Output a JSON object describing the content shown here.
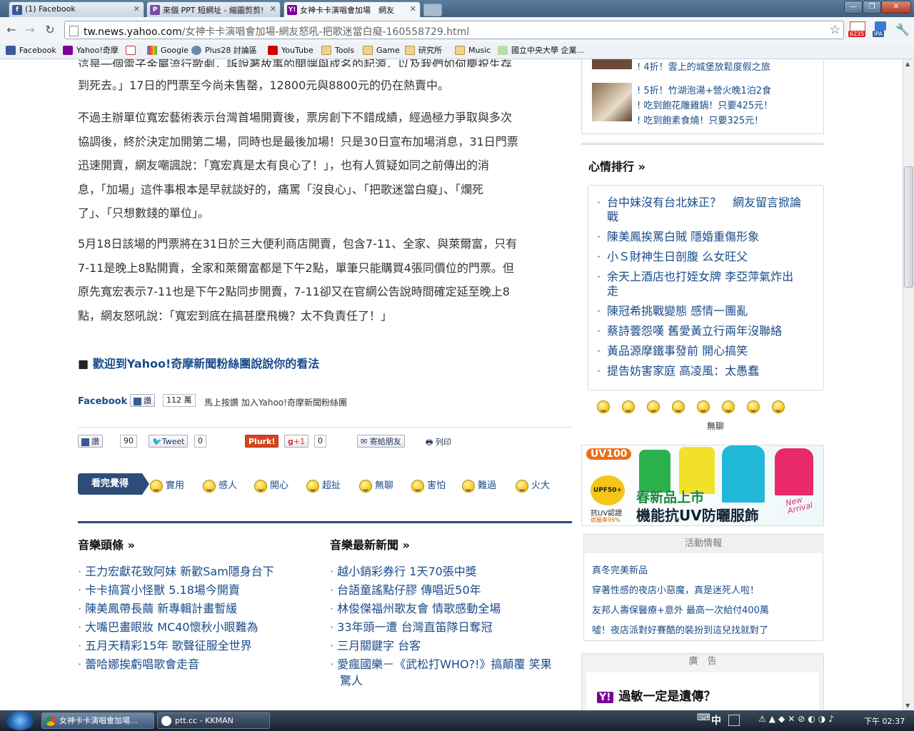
{
  "browser": {
    "tabs": [
      {
        "label": "(1) Facebook",
        "icon": "facebook-icon",
        "color": "#3b5998"
      },
      {
        "label": "來個 PPT 短網址 - 縮圖剪剪!",
        "icon": "ppt-icon",
        "color": "#7a4da0"
      },
      {
        "label": "女神卡卡演唱會加場　網友",
        "icon": "yahoo-icon",
        "color": "#7b0099"
      }
    ],
    "url_host": "tw.news.yahoo.com",
    "url_path": "/女神卡卡演唱會加場-網友怒吼-把歌迷當白癡-160558729.html",
    "ext_badge_1": "6235",
    "ext_badge_2": "IPA",
    "bookmarks": [
      {
        "label": "Facebook",
        "icon": "facebook-icon"
      },
      {
        "label": "Yahoo!奇摩",
        "icon": "yahoo-icon"
      },
      {
        "label": "",
        "icon": "gmail-icon"
      },
      {
        "label": "Google",
        "icon": "google-icon"
      },
      {
        "label": "Plus28 討論區",
        "icon": "plus28-icon"
      },
      {
        "label": "YouTube",
        "icon": "youtube-icon"
      },
      {
        "label": "Tools",
        "icon": "folder-icon"
      },
      {
        "label": "Game",
        "icon": "folder-icon"
      },
      {
        "label": "研究所",
        "icon": "folder-icon"
      },
      {
        "label": "Music",
        "icon": "folder-icon"
      },
      {
        "label": "國立中央大學 企業...",
        "icon": "ncu-icon"
      }
    ]
  },
  "article": {
    "para1_top": "這是一個電子金屬流行歌劇，訴說著故事的開端與成名的起源，以及我們如何慶祝生存",
    "para1_mid": "到死去。」17日的門票至今尚未售罄，12800元與8800元的仍在熱賣中。",
    "para2": [
      "不過主辦單位寬宏藝術表示台灣首場開賣後，票房創下不錯成績，經過極力爭取與多次",
      "協調後，終於決定加開第二場，同時也是最後加場！只是30日宣布加場消息，31日門票",
      "迅速開賣，網友嘲諷說：「寬宏真是太有良心了！」，也有人質疑如同之前傳出的消",
      "息，「加場」這件事根本是早就談好的，痛罵「沒良心」、「把歌迷當白癡」、「爛死",
      "了」、「只想數錢的單位」。"
    ],
    "para3": [
      "5月18日該場的門票將在31日於三大便利商店開賣，包含7-11、全家、與萊爾富，只有",
      "7-11是晚上8點開賣，全家和萊爾富都是下午2點，單筆只能購買4張同價位的門票。但",
      "原先寬宏表示7-11也是下午2點同步開賣，7-11卻又在官網公告說時間確定延至晚上8",
      "點，網友怒吼說：「寬宏到底在搞甚麼飛機？太不負責任了！」"
    ],
    "fan_heading": "歡迎到Yahoo!奇摩新聞粉絲團說說你的看法",
    "facebook_label": "Facebook",
    "like_label": "讚",
    "like_count": "112 萬",
    "join_text": "馬上按讚 加入Yahoo!奇摩新聞粉絲團"
  },
  "share_bar": {
    "fb_label": "讚",
    "fb_count": "90",
    "tweet_label": "Tweet",
    "tweet_count": "0",
    "plurk_label": "Plurk!",
    "gplus_label": "+1",
    "gplus_count": "0",
    "mail_label": "寄給朋友",
    "print_label": "列印"
  },
  "mood": {
    "title": "看完覺得",
    "items": [
      "實用",
      "感人",
      "開心",
      "超扯",
      "無聊",
      "害怕",
      "難過",
      "火大"
    ]
  },
  "music_headlines": {
    "title": "音樂頭條 »",
    "items": [
      "王力宏獻花致阿妹 新歡Sam隱身台下",
      "卡卡搞賞小怪獸 5.18場今開賣",
      "陳美鳳帶長繭 新專輯計畫暫緩",
      "大嘴巴畫眼妝 MC40懷秋小眼難為",
      "五月天精彩15年 歌聲征服全世界",
      "蕾哈娜挨虧唱歌會走音"
    ]
  },
  "music_latest": {
    "title": "音樂最新新聞 »",
    "items": [
      "越小銷彩券行 1天70張中獎",
      "台語童謠點仔膠 傳唱近50年",
      "林俊傑福州歌友會 情歌感動全場",
      "33年頭一遭 台灣直笛隊日奪冠",
      "三月關鍵字 台客"
    ],
    "last_item_line1": "愛瘋國樂－《武松打WHO?!》搞顛覆 笑果",
    "last_item_line2": "驚人"
  },
  "sidebar": {
    "promo_top": "4折！雲上的城堡放鬆度假之旅",
    "promo_lines": [
      "5折！竹湖泡湯+營火晚1泊2食",
      "吃到飽花雕雞鍋！只要425元！",
      "吃到飽素食燒！只要325元！"
    ],
    "ranking_title": "心情排行 »",
    "ranking": [
      [
        "台中妹沒有台北妹正？　網友留言掀論",
        "戰"
      ],
      [
        "陳美鳳挨罵白賊 隱婚重傷形象"
      ],
      [
        "小Ｓ財神生日剖腹 么女旺父"
      ],
      [
        "余天上酒店也打姪女牌 李亞萍氣炸出",
        "走"
      ],
      [
        "陳冠希挑戰變態 感情一團亂"
      ],
      [
        "蔡詩蕓怨嘆 舊愛黃立行兩年沒聯絡"
      ],
      [
        "黃品源摩鐵事發前 開心搞笑"
      ],
      [
        "提告妨害家庭 高凌風：太愚蠢"
      ]
    ],
    "mood_active_label": "無聊",
    "ad_brand": "UV100",
    "ad_badge": "UPF50+",
    "ad_badge_text": "抗UV認證",
    "ad_badge_sub": "遮蔽率99%",
    "ad_line1": "春新品上市",
    "ad_line2": "機能抗UV防曬服飾",
    "ad_tag": "New Arrival",
    "events_title": "活動情報",
    "events": [
      "真冬完美新品",
      "穿著性感的夜店小惡魔，真是迷死人啦！",
      "友邦人壽保醫療+意外 最高一次給付400萬",
      "噓！夜店派對好賽酷的裝扮到這兒找就對了"
    ],
    "ad2_title": "廣　告",
    "ad2_text": "過敏一定是遺傳？"
  },
  "taskbar": {
    "tasks": [
      "女神卡卡演唱會加場...",
      "ptt.cc - KKMAN"
    ],
    "ime": "中",
    "clock": "下午 02:37"
  }
}
